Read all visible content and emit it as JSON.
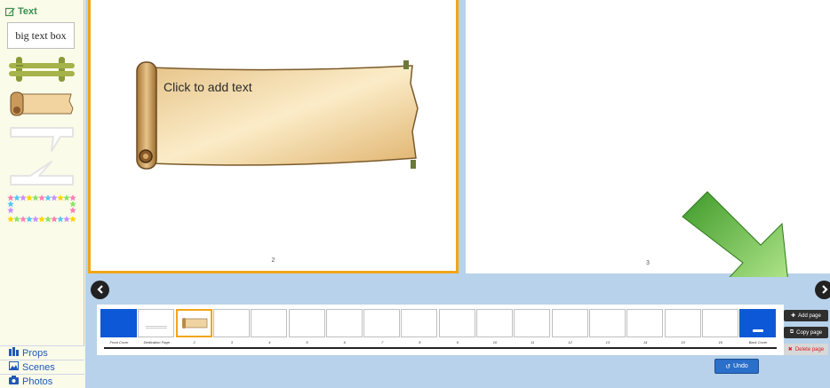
{
  "sidebar": {
    "header_label": "Text",
    "big_text_box_label": "big text box",
    "bottom_items": [
      {
        "label": "Props",
        "icon": "props-icon"
      },
      {
        "label": "Scenes",
        "icon": "scenes-icon"
      },
      {
        "label": "Photos",
        "icon": "camera-icon"
      }
    ],
    "assets": [
      "bamboo-sign",
      "parchment-scroll",
      "speech-bubble-1",
      "speech-bubble-2",
      "star-border-frame"
    ]
  },
  "pages": {
    "left": {
      "number": "2",
      "placeholder": "Click to add text"
    },
    "right": {
      "number": "3"
    }
  },
  "filmstrip": {
    "thumbnails": [
      {
        "label": "Front Cover",
        "type": "cover"
      },
      {
        "label": "Dedication Page",
        "type": "dedication"
      },
      {
        "label": "2",
        "type": "selected"
      },
      {
        "label": "3",
        "type": "page"
      },
      {
        "label": "4",
        "type": "page"
      },
      {
        "label": "5",
        "type": "page"
      },
      {
        "label": "6",
        "type": "page"
      },
      {
        "label": "7",
        "type": "page"
      },
      {
        "label": "8",
        "type": "page"
      },
      {
        "label": "9",
        "type": "page"
      },
      {
        "label": "10",
        "type": "page"
      },
      {
        "label": "11",
        "type": "page"
      },
      {
        "label": "12",
        "type": "page"
      },
      {
        "label": "13",
        "type": "page"
      },
      {
        "label": "14",
        "type": "page"
      },
      {
        "label": "15",
        "type": "page"
      },
      {
        "label": "16",
        "type": "page"
      },
      {
        "label": "Back Cover",
        "type": "cover"
      }
    ]
  },
  "actions": {
    "add_page": "Add page",
    "copy_page": "Copy page",
    "delete_page": "Delete page",
    "undo": "Undo"
  },
  "colors": {
    "accent_orange": "#f2a51a",
    "cover_blue": "#0d58d6",
    "panel_blue": "#b7d2ea",
    "sidebar_link": "#1f58b8",
    "delete_red": "#d62020",
    "arrow_green": "#5cba3c"
  }
}
